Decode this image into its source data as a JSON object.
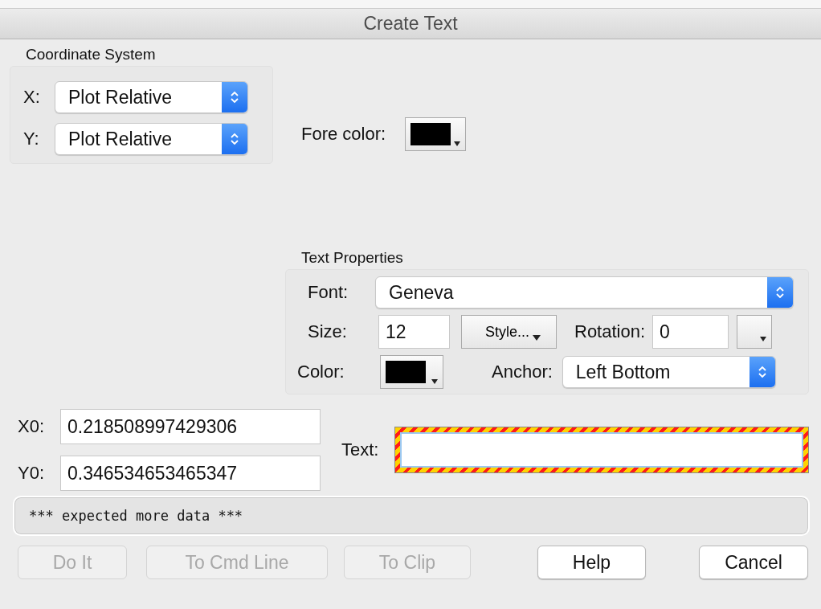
{
  "window": {
    "title": "Create Text"
  },
  "coordinate_system": {
    "title": "Coordinate System",
    "x": {
      "label": "X:",
      "value": "Plot Relative"
    },
    "y": {
      "label": "Y:",
      "value": "Plot Relative"
    }
  },
  "fore_color": {
    "label": "Fore color:",
    "color": "#000000"
  },
  "text_properties": {
    "title": "Text Properties",
    "font": {
      "label": "Font:",
      "value": "Geneva"
    },
    "size": {
      "label": "Size:",
      "value": "12"
    },
    "style_button": "Style...",
    "rotation": {
      "label": "Rotation:",
      "value": "0"
    },
    "color": {
      "label": "Color:",
      "color": "#000000"
    },
    "anchor": {
      "label": "Anchor:",
      "value": "Left Bottom"
    }
  },
  "x0": {
    "label": "X0:",
    "value": "0.218508997429306"
  },
  "y0": {
    "label": "Y0:",
    "value": "0.346534653465347"
  },
  "text_field": {
    "label": "Text:",
    "invalid": true
  },
  "status": "*** expected more data ***",
  "buttons": [
    {
      "label": "Do It",
      "disabled": true
    },
    {
      "label": "To Cmd Line",
      "disabled": true
    },
    {
      "label": "To Clip",
      "disabled": true
    },
    {
      "label": "Help",
      "disabled": false
    },
    {
      "label": "Cancel",
      "disabled": false
    }
  ]
}
